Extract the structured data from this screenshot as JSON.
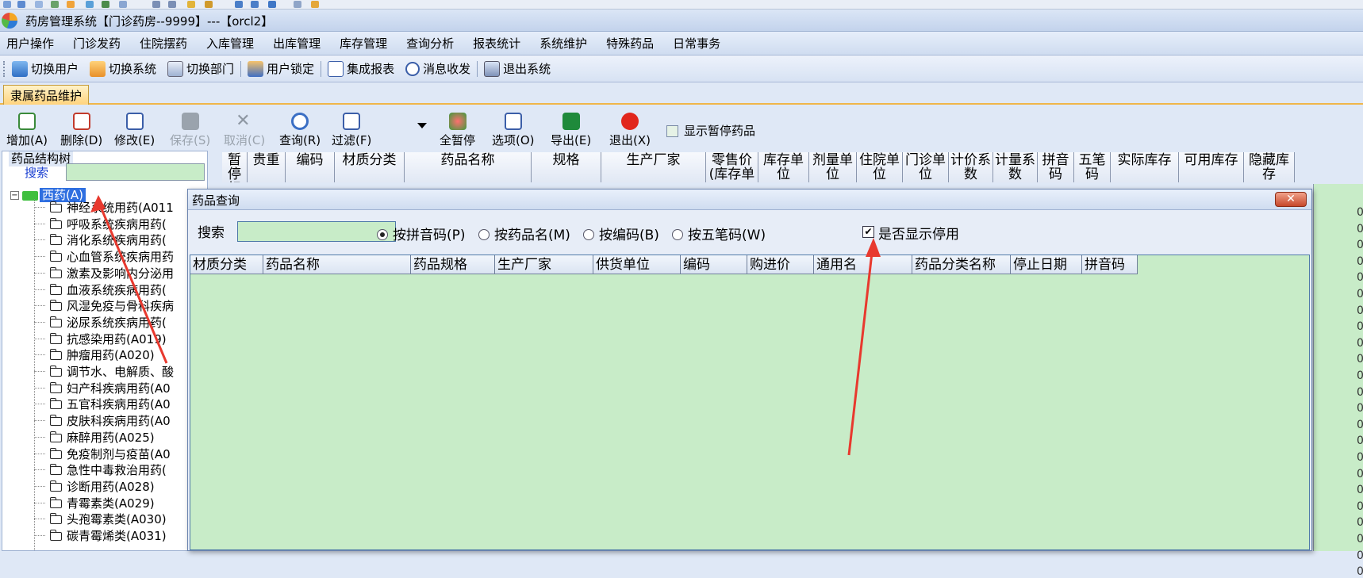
{
  "window": {
    "title": "药房管理系统【门诊药房--9999】---【orcl2】"
  },
  "menu": [
    "用户操作",
    "门诊发药",
    "住院摆药",
    "入库管理",
    "出库管理",
    "库存管理",
    "查询分析",
    "报表统计",
    "系统维护",
    "特殊药品",
    "日常事务"
  ],
  "quick_toolbar": [
    {
      "label": "切换用户",
      "icon": "switch-user-icon"
    },
    {
      "label": "切换系统",
      "icon": "switch-system-icon"
    },
    {
      "label": "切换部门",
      "icon": "switch-dept-icon"
    },
    {
      "label": "用户锁定",
      "icon": "user-lock-icon"
    },
    {
      "label": "集成报表",
      "icon": "report-icon"
    },
    {
      "label": "消息收发",
      "icon": "info-icon"
    },
    {
      "label": "退出系统",
      "icon": "exit-icon"
    }
  ],
  "tab": {
    "label": "隶属药品维护"
  },
  "actions": {
    "add": "增加(A)",
    "delete": "删除(D)",
    "edit": "修改(E)",
    "save": "保存(S)",
    "cancel": "取消(C)",
    "query": "查询(R)",
    "filter": "过滤(F)",
    "pause_all": "全暂停",
    "options": "选项(O)",
    "export": "导出(E)",
    "exit": "退出(X)",
    "show_paused": "显示暂停药品"
  },
  "tree": {
    "title": "药品结构树",
    "search_label": "搜索",
    "root": "西药(A)",
    "items": [
      "神经系统用药(A011",
      "呼吸系统疾病用药(",
      "消化系统疾病用药(",
      "心血管系统疾病用药",
      "激素及影响内分泌用",
      "血液系统疾病用药(",
      "风湿免疫与骨科疾病",
      "泌尿系统疾病用药(",
      "抗感染用药(A019)",
      "肿瘤用药(A020)",
      "调节水、电解质、酸",
      "妇产科疾病用药(A0",
      "五官科疾病用药(A0",
      "皮肤科疾病用药(A0",
      "麻醉用药(A025)",
      "免疫制剂与疫苗(A0",
      "急性中毒救治用药(",
      "诊断用药(A028)",
      "青霉素类(A029)",
      "头孢霉素类(A030)",
      "碳青霉烯类(A031)"
    ]
  },
  "grid_headers": [
    "暂停标志",
    "贵重",
    "编码",
    "材质分类",
    "药品名称",
    "规格",
    "生产厂家",
    "零售价(库存单",
    "库存单位",
    "剂量单位",
    "住院单位",
    "门诊单位",
    "计价系数",
    "计量系数",
    "拼音码",
    "五笔码",
    "实际库存",
    "可用库存",
    "隐藏库存"
  ],
  "grid_zero": "0",
  "dialog": {
    "title": "药品查询",
    "close": "✕",
    "search_label": "搜索",
    "radios": [
      "按拼音码(P)",
      "按药品名(M)",
      "按编码(B)",
      "按五笔码(W)"
    ],
    "selected_radio": 0,
    "show_disabled": "是否显示停用",
    "show_disabled_checked": true,
    "columns": [
      "材质分类",
      "药品名称",
      "药品规格",
      "生产厂家",
      "供货单位",
      "编码",
      "购进价",
      "通用名",
      "药品分类名称",
      "停止日期",
      "拼音码"
    ]
  },
  "colors": {
    "grid_bg": "#c8ecc8",
    "tab_accent": "#ffd27a",
    "annotation_arrow": "#e8392e"
  }
}
